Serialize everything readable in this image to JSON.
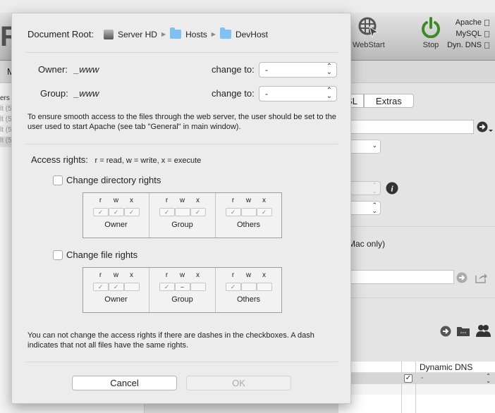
{
  "background": {
    "logo_fragment": "R",
    "toolbar": {
      "webstart_label": "WebStart",
      "stop_label": "Stop",
      "status": [
        "Apache",
        "MySQL",
        "Dyn. DNS"
      ]
    },
    "tab_fragment": "M",
    "tabs": [
      "SL",
      "Extras"
    ],
    "sidebar_rows": [
      "ers",
      "lt (5",
      "lt (5",
      "lt (5",
      "lt (5"
    ],
    "mac_only_text": "Mac only)",
    "table_header": "Dynamic DNS",
    "table_row_value": "-"
  },
  "dialog": {
    "document_root_label": "Document Root:",
    "breadcrumb": [
      "Server HD",
      "Hosts",
      "DevHost"
    ],
    "owner_label": "Owner:",
    "owner_value": "_www",
    "group_label": "Group:",
    "group_value": "_www",
    "change_to_label": "change to:",
    "owner_change_value": "-",
    "group_change_value": "-",
    "apache_note": "To ensure smooth access to the files through the web server, the user should be set to the user used to start Apache (see tab \"General\" in main window).",
    "access_rights_label": "Access rights:",
    "legend": "r = read, w = write, x = execute",
    "perm_letters": [
      "r",
      "w",
      "x"
    ],
    "directory": {
      "label": "Change directory rights",
      "checked": false,
      "groups": [
        {
          "name": "Owner",
          "r": "checked",
          "w": "checked",
          "x": "checked"
        },
        {
          "name": "Group",
          "r": "checked",
          "w": "unchecked",
          "x": "checked"
        },
        {
          "name": "Others",
          "r": "checked",
          "w": "unchecked",
          "x": "checked"
        }
      ]
    },
    "file": {
      "label": "Change file rights",
      "checked": false,
      "groups": [
        {
          "name": "Owner",
          "r": "checked",
          "w": "checked",
          "x": "unchecked"
        },
        {
          "name": "Group",
          "r": "checked",
          "w": "mixed",
          "x": "unchecked"
        },
        {
          "name": "Others",
          "r": "checked",
          "w": "unchecked",
          "x": "unchecked"
        }
      ]
    },
    "dash_note": "You can not change the access rights if there are dashes in the checkboxes. A dash indicates that not all files have the same rights.",
    "cancel_label": "Cancel",
    "ok_label": "OK"
  }
}
